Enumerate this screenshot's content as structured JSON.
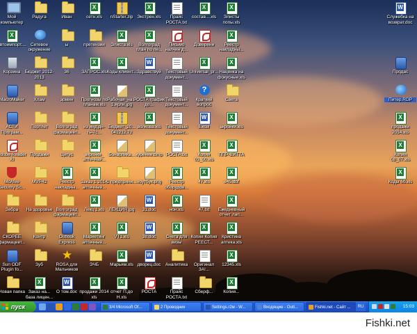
{
  "desktop": {
    "icons": [
      {
        "label": "Мой компьютер",
        "type": "pc"
      },
      {
        "label": "Радуга",
        "type": "folder"
      },
      {
        "label": "Иван",
        "type": "folder"
      },
      {
        "label": "сетн.xls",
        "type": "xls"
      },
      {
        "label": "nStarter.zip",
        "type": "zip"
      },
      {
        "label": "Экстрен.xls",
        "type": "xls"
      },
      {
        "label": "Прайс РОСТА.txt",
        "type": "txt"
      },
      {
        "label": "состав....xls",
        "type": "xls"
      },
      {
        "label": "Элисты попы.xls",
        "type": "xls"
      },
      {
        "label": "автоимпорт....",
        "type": "xls"
      },
      {
        "label": "Сетевое окружение",
        "type": "net"
      },
      {
        "label": "ы",
        "type": "folder"
      },
      {
        "label": "претензии",
        "type": "folder"
      },
      {
        "label": "Элиста.xls",
        "type": "xls"
      },
      {
        "label": "Волгоград план по пе...",
        "type": "xls"
      },
      {
        "label": "Письмо налчин д...",
        "type": "pdf"
      },
      {
        "label": "Доверени",
        "type": "pdf"
      },
      {
        "label": "Реестр накладны...",
        "type": "xls"
      },
      {
        "label": "Корзина",
        "type": "bin"
      },
      {
        "label": "Бюджет 2012-2013",
        "type": "folder"
      },
      {
        "label": "36",
        "type": "folder"
      },
      {
        "label": "ЗАПРОС.xls",
        "type": "xls"
      },
      {
        "label": "Коды клиент...",
        "type": "xls"
      },
      {
        "label": "Здравствуй",
        "type": "doc"
      },
      {
        "label": "Текстовый документ...",
        "type": "txt"
      },
      {
        "label": "Universal_pr...",
        "type": "xls"
      },
      {
        "label": "Наценка на фокусные.xls",
        "type": "xls"
      },
      {
        "label": "MacroMaker",
        "type": "app"
      },
      {
        "label": "Хлам",
        "type": "folder"
      },
      {
        "label": "эрмин",
        "type": "folder"
      },
      {
        "label": "Прогнозы по планам.xls",
        "type": "xls"
      },
      {
        "label": "Рабочая_на... 1.ярли.jpg",
        "type": "bmp"
      },
      {
        "label": "РОСТА график до...",
        "type": "xls"
      },
      {
        "label": "Текстовый документ...",
        "type": "txt"
      },
      {
        "label": "Краткий вопрос",
        "type": "help"
      },
      {
        "label": "Света",
        "type": "folder"
      },
      {
        "label": "АСТИ Програм...",
        "type": "app"
      },
      {
        "label": "Портлет",
        "type": "folder"
      },
      {
        "label": "Волгоград фармацевт...",
        "type": "folder"
      },
      {
        "label": "из инд.дн-ть-7с...",
        "type": "xls"
      },
      {
        "label": "Бюджет_20... 041212.7z",
        "type": "zip"
      },
      {
        "label": "волкова.xls",
        "type": "xls"
      },
      {
        "label": "Текстовый документ...",
        "type": "txt"
      },
      {
        "label": "Excel",
        "type": "doc"
      },
      {
        "label": "акройки.xls",
        "type": "xls"
      },
      {
        "label": "Adobe Reader XI",
        "type": "pdf"
      },
      {
        "label": "Продажи",
        "type": "folder"
      },
      {
        "label": "Цетус",
        "type": "folder"
      },
      {
        "label": "акройки_ аптечная...",
        "type": "xls"
      },
      {
        "label": "Бонарпика...",
        "type": "bmp"
      },
      {
        "label": "курение.bmp",
        "type": "bmp"
      },
      {
        "label": "РОСТА.txt",
        "type": "txt"
      },
      {
        "label": "Копия 01_00.xls",
        "type": "xls"
      },
      {
        "label": "ППР-ВИТТА",
        "type": "xls"
      },
      {
        "label": "McAfee Security Sc...",
        "type": "shield"
      },
      {
        "label": "MVP42",
        "type": "folder"
      },
      {
        "label": "Реестр накладны...",
        "type": "xls"
      },
      {
        "label": "Заказ 1 2014 аптечный...",
        "type": "xls"
      },
      {
        "label": "1 предприни...",
        "type": "folder"
      },
      {
        "label": "ноутбук.png",
        "type": "bmp"
      },
      {
        "label": "Реестр оборудов...",
        "type": "xls"
      },
      {
        "label": "47.xls",
        "type": "xls"
      },
      {
        "label": "е45.dbf",
        "type": "xls"
      },
      {
        "label": "Зебра",
        "type": "folder"
      },
      {
        "label": "На здоровье",
        "type": "folder"
      },
      {
        "label": "Волгоград фармацевт...",
        "type": "folder"
      },
      {
        "label": "Лекц 1.xls",
        "type": "xls"
      },
      {
        "label": "ЛЕКЦИЯ.jpg",
        "type": "bmp"
      },
      {
        "label": "31.doc",
        "type": "doc"
      },
      {
        "label": "нон.xls",
        "type": "xls"
      },
      {
        "label": "47.txt",
        "type": "txt"
      },
      {
        "label": "Ежедневный отчет лап...",
        "type": "xls"
      },
      {
        "label": "СКОРЕЕ фармацевт...",
        "type": "folder"
      },
      {
        "label": "Контр",
        "type": "folder"
      },
      {
        "label": "Outlook Express",
        "type": "app"
      },
      {
        "label": "Маркетинг аптечный...",
        "type": "xls"
      },
      {
        "label": "VT1.xls",
        "type": "xls"
      },
      {
        "label": "38.doc",
        "type": "doc"
      },
      {
        "label": "Счета для визы",
        "type": "xls"
      },
      {
        "label": "Копия Копия РЕЕСТ...",
        "type": "xls"
      },
      {
        "label": "Кристина аптека.xls",
        "type": "xls"
      },
      {
        "label": "Sun ODF Plugin fo...",
        "type": "app"
      },
      {
        "label": "Зуб",
        "type": "folder"
      },
      {
        "label": "ROSA для Мальчиков",
        "type": "star"
      },
      {
        "label": "ЭЧБ",
        "type": "folder"
      },
      {
        "label": "Марьям.xls",
        "type": "xls"
      },
      {
        "label": "дворец.doc",
        "type": "doc"
      },
      {
        "label": "Аналитика",
        "type": "folder"
      },
      {
        "label": "Оригинал ЗА!...",
        "type": "txt"
      },
      {
        "label": "12345.xls",
        "type": "xls"
      },
      {
        "label": "Новая папка",
        "type": "folder"
      },
      {
        "label": "Заказ на... база лицен...",
        "type": "xls"
      },
      {
        "label": "О том.doc",
        "type": "doc"
      },
      {
        "label": "продажи 2014 xls",
        "type": "xls"
      },
      {
        "label": "отчет П.до Н.xls",
        "type": "xls"
      },
      {
        "label": "РОСТА",
        "type": "pdf"
      },
      {
        "label": "Прайс РОСТА.txt",
        "type": "txt"
      },
      {
        "label": "Сберф...",
        "type": "folder"
      },
      {
        "label": "Копия...",
        "type": "xls"
      },
      {
        "label": "Служебка на возврат.doc",
        "type": "doc"
      },
      {
        "label": "Продас",
        "type": "app"
      },
      {
        "label": "Питер.RDP",
        "type": "net",
        "selected": true
      },
      {
        "label": "продажи 2014.xls",
        "type": "xls"
      },
      {
        "label": "Копия 08_07.xls",
        "type": "xls"
      },
      {
        "label": "Коды 6б.xls",
        "type": "xls"
      }
    ]
  },
  "taskbar": {
    "start_label": "пуск",
    "windows": [
      {
        "label": "3/4 Microsoft Of...",
        "color": "#2e7d32",
        "active": false
      },
      {
        "label": "2 Проводник",
        "color": "#f1d46a",
        "active": false
      },
      {
        "label": "Settings.r2м - W...",
        "color": "#2a55b0",
        "active": false
      },
      {
        "label": "Входящие - Outl...",
        "color": "#4f83d8",
        "active": false
      },
      {
        "label": "Fishki.net - Сайт ...",
        "color": "#e8a020",
        "active": true
      }
    ],
    "language": "RU",
    "clock": "15:03"
  },
  "watermark": "Fishki.net"
}
